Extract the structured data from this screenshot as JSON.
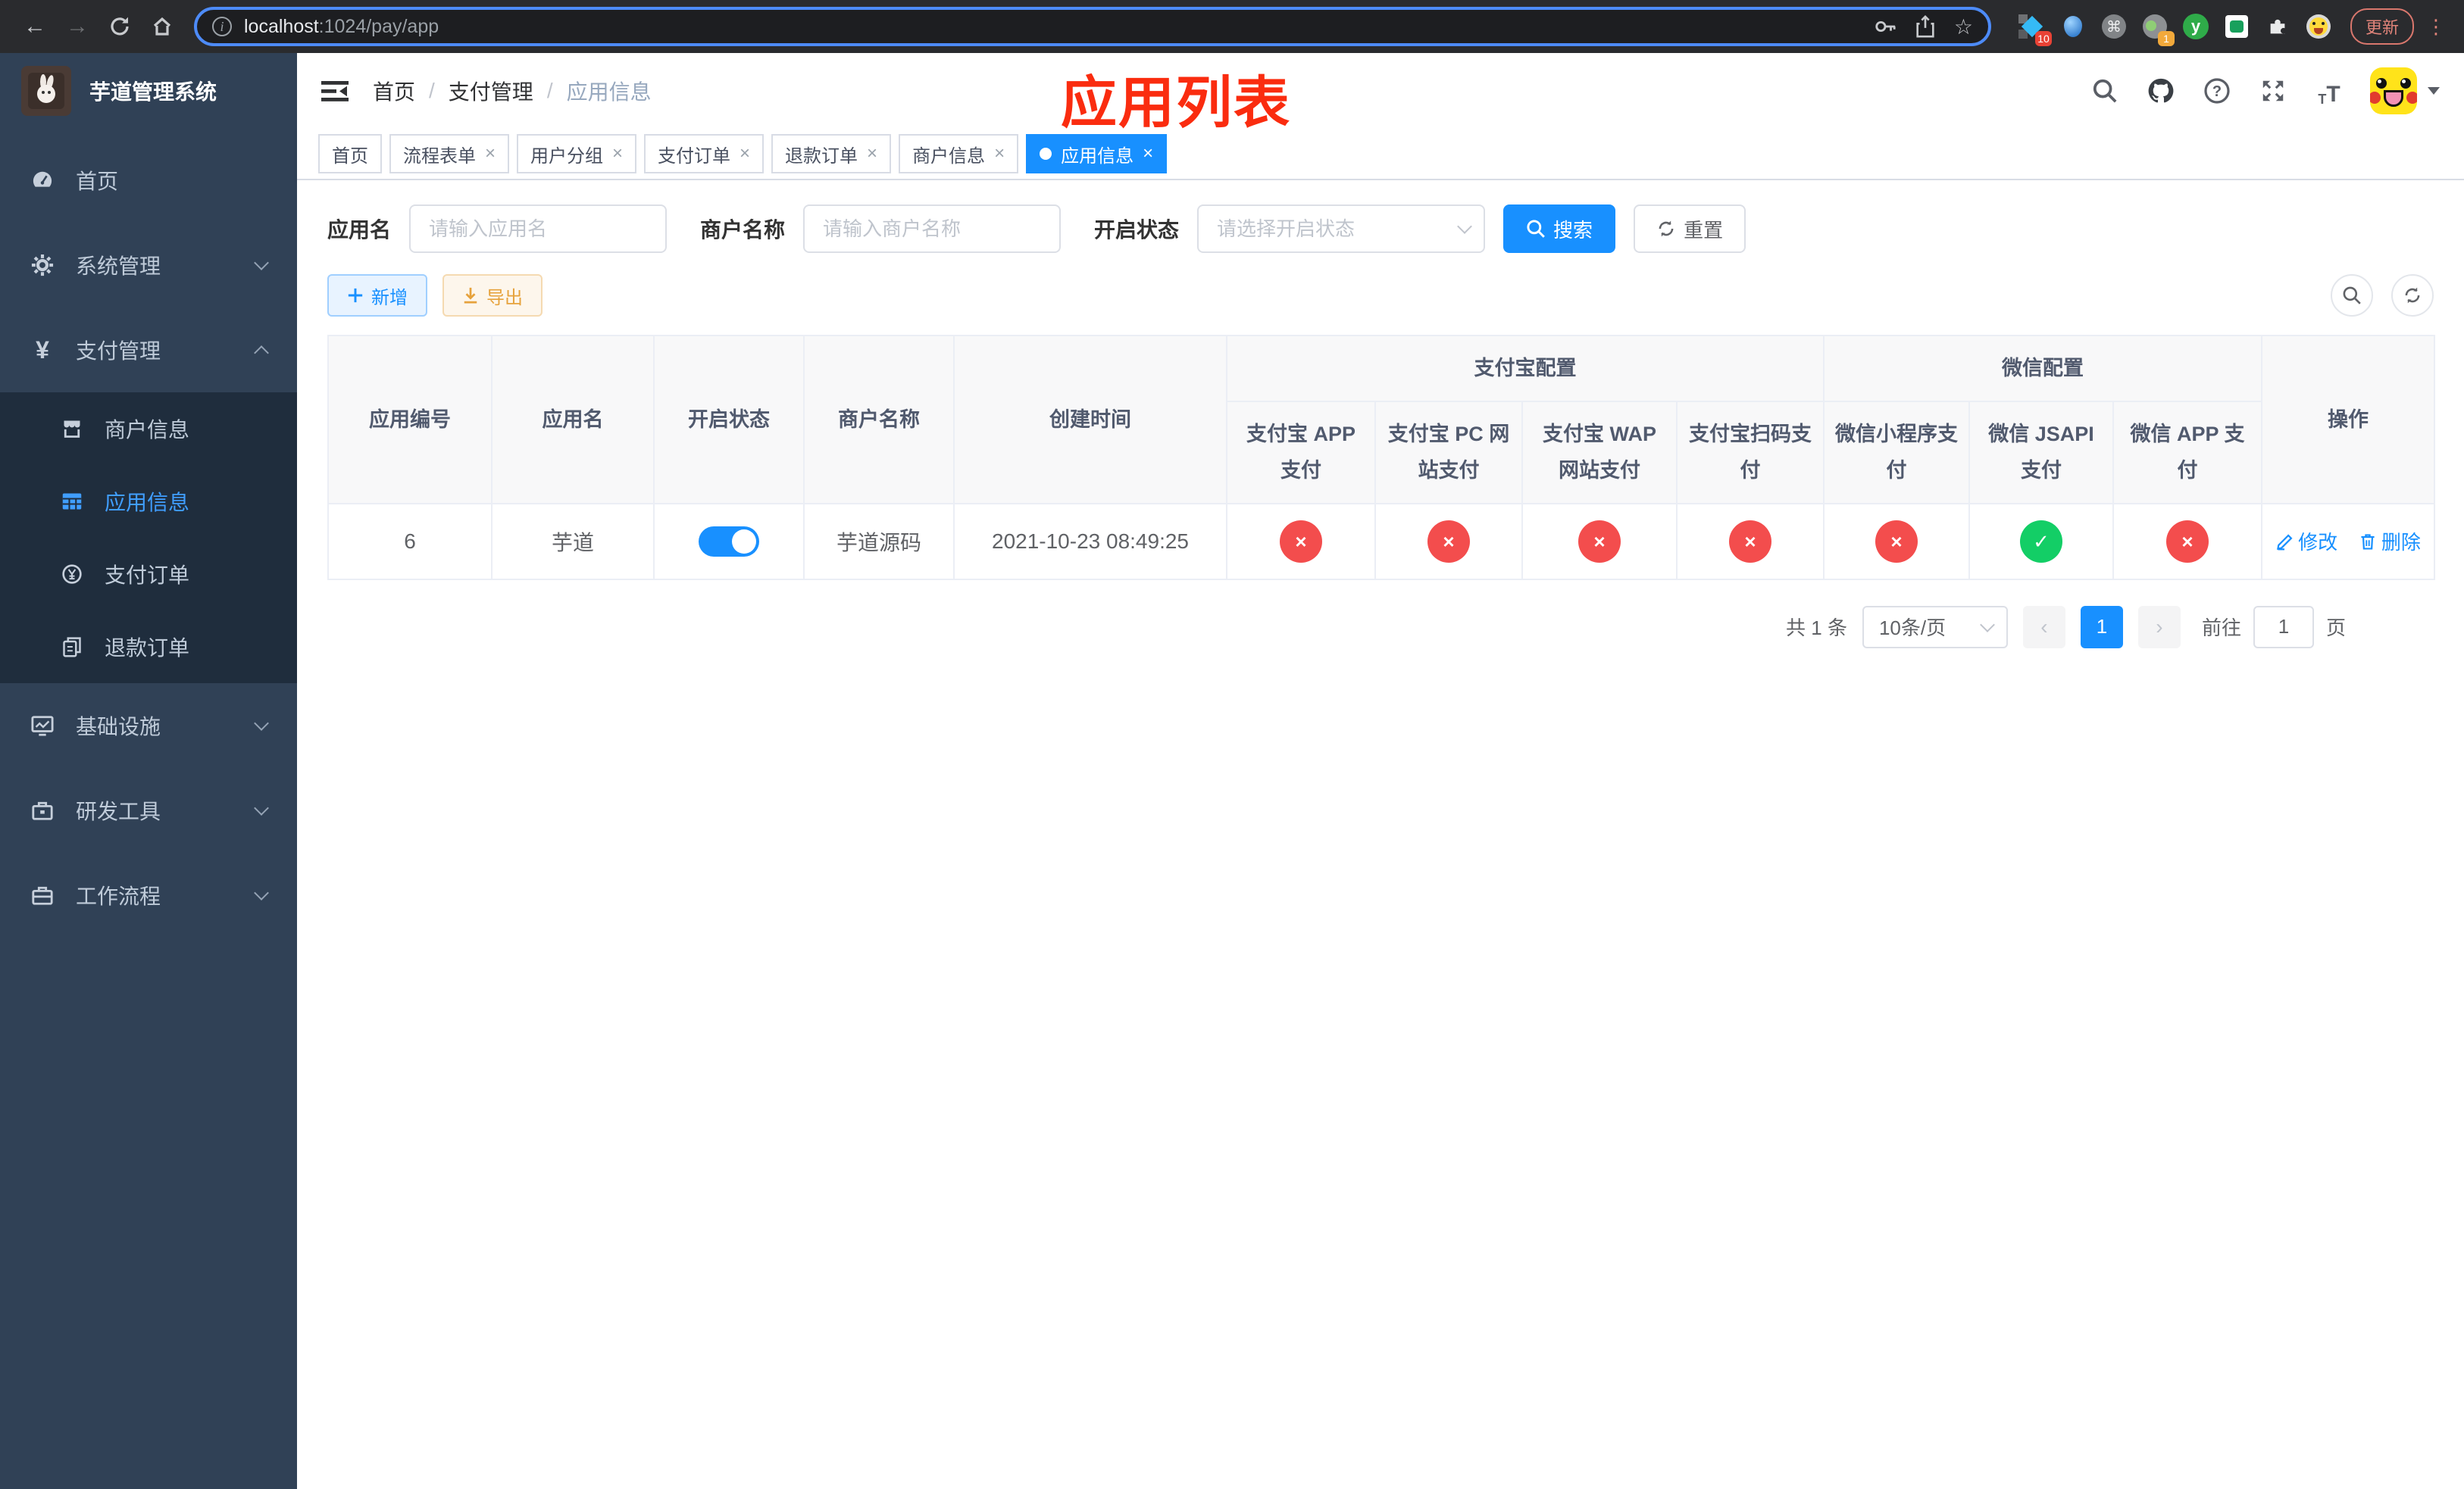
{
  "browser": {
    "url_host": "localhost",
    "url_path": ":1024/pay/app",
    "ext_badge_blue_diamond": "10",
    "ext_badge_camera": "1",
    "ext_y_label": "y",
    "update_label": "更新"
  },
  "sidebar": {
    "title": "芋道管理系统",
    "items": {
      "home": "首页",
      "system": "系统管理",
      "payment": "支付管理",
      "merchant": "商户信息",
      "app": "应用信息",
      "pay_order": "支付订单",
      "refund_order": "退款订单",
      "infra": "基础设施",
      "devtools": "研发工具",
      "workflow": "工作流程"
    }
  },
  "header": {
    "breadcrumb": [
      "首页",
      "支付管理",
      "应用信息"
    ],
    "annotation": "应用列表",
    "annotation_color": "#fa2c0f"
  },
  "tabs": [
    {
      "label": "首页",
      "closable": false,
      "active": false
    },
    {
      "label": "流程表单",
      "closable": true,
      "active": false
    },
    {
      "label": "用户分组",
      "closable": true,
      "active": false
    },
    {
      "label": "支付订单",
      "closable": true,
      "active": false
    },
    {
      "label": "退款订单",
      "closable": true,
      "active": false
    },
    {
      "label": "商户信息",
      "closable": true,
      "active": false
    },
    {
      "label": "应用信息",
      "closable": true,
      "active": true
    }
  ],
  "close_glyph": "×",
  "filters": {
    "app_name_label": "应用名",
    "app_name_placeholder": "请输入应用名",
    "merchant_label": "商户名称",
    "merchant_placeholder": "请输入商户名称",
    "status_label": "开启状态",
    "status_placeholder": "请选择开启状态",
    "search_label": "搜索",
    "reset_label": "重置"
  },
  "toolbar": {
    "add_label": "新增",
    "export_label": "导出"
  },
  "table": {
    "group_alipay": "支付宝配置",
    "group_wechat": "微信配置",
    "columns": {
      "id": "应用编号",
      "name": "应用名",
      "status": "开启状态",
      "merchant": "商户名称",
      "created": "创建时间",
      "alipay_app": "支付宝 APP 支付",
      "alipay_pc": "支付宝 PC 网站支付",
      "alipay_wap": "支付宝 WAP 网站支付",
      "alipay_qr": "支付宝扫码支付",
      "wx_mini": "微信小程序支付",
      "wx_jsapi": "微信 JSAPI 支付",
      "wx_app": "微信 APP 支付",
      "actions": "操作"
    },
    "row": {
      "id": "6",
      "name": "芋道",
      "enabled": true,
      "merchant": "芋道源码",
      "created": "2021-10-23 08:49:25",
      "configs": [
        {
          "state": "no",
          "glyph": "×"
        },
        {
          "state": "no",
          "glyph": "×"
        },
        {
          "state": "no",
          "glyph": "×"
        },
        {
          "state": "no",
          "glyph": "×"
        },
        {
          "state": "no",
          "glyph": "×"
        },
        {
          "state": "ok",
          "glyph": "✓"
        },
        {
          "state": "no",
          "glyph": "×"
        }
      ],
      "edit_label": "修改",
      "delete_label": "删除"
    }
  },
  "pagination": {
    "total": "共 1 条",
    "page_size": "10条/页",
    "page": "1",
    "goto_label": "前往",
    "goto_value": "1",
    "page_unit": "页"
  },
  "colors": {
    "accent": "#1890ff",
    "danger": "#f34d4d",
    "success": "#13ce66",
    "sidebar": "#304156",
    "submenu": "#1f2d3d"
  }
}
